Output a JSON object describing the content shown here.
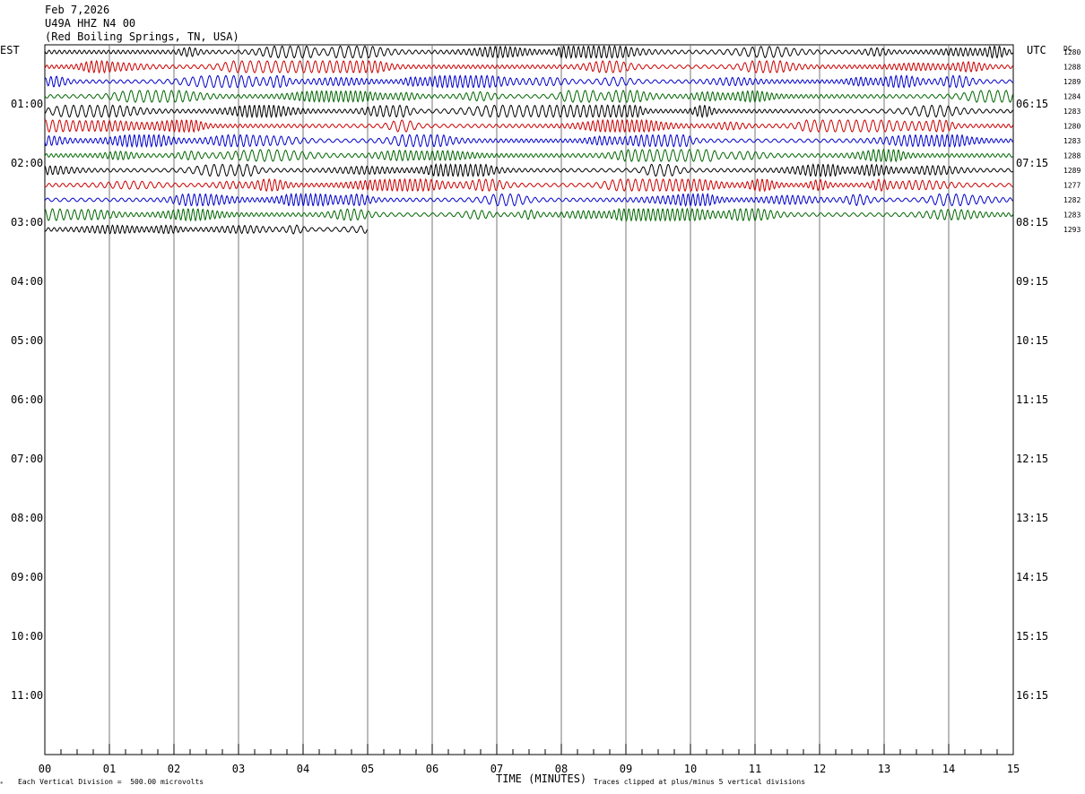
{
  "header": {
    "date": "Feb 7,2026",
    "station": "U49A HHZ N4 00",
    "location": "(Red Boiling Springs, TN, USA)"
  },
  "left_tz": "EST",
  "right_tz": "UTC",
  "dc_label": "DC",
  "footer": {
    "scale_note": "Each Vertical Division =  500.00 microvolts",
    "clip_note": "Traces clipped at plus/minus 5 vertical divisions",
    "xlabel": "TIME (MINUTES)"
  },
  "chart_data": {
    "type": "line",
    "title": "U49A HHZ N4 00",
    "xlabel": "TIME (MINUTES)",
    "xlim": [
      0,
      15
    ],
    "x_ticks": [
      "00",
      "01",
      "02",
      "03",
      "04",
      "05",
      "06",
      "07",
      "08",
      "09",
      "10",
      "11",
      "12",
      "13",
      "14",
      "15"
    ],
    "left_hour_labels": [
      "01:00",
      "02:00",
      "03:00",
      "04:00",
      "05:00",
      "06:00",
      "07:00",
      "08:00",
      "09:00",
      "10:00",
      "11:00"
    ],
    "right_hour_labels": [
      "06:15",
      "07:15",
      "08:15",
      "09:15",
      "10:15",
      "11:15",
      "12:15",
      "13:15",
      "14:15",
      "15:15",
      "16:15"
    ],
    "trace_colors": [
      "#000000",
      "#cc0000",
      "#0000cc",
      "#006600"
    ],
    "traces": [
      {
        "dc": "1280",
        "minutes": 15
      },
      {
        "dc": "1288",
        "minutes": 15
      },
      {
        "dc": "1289",
        "minutes": 15
      },
      {
        "dc": "1284",
        "minutes": 15
      },
      {
        "dc": "1283",
        "minutes": 15
      },
      {
        "dc": "1280",
        "minutes": 15
      },
      {
        "dc": "1283",
        "minutes": 15
      },
      {
        "dc": "1288",
        "minutes": 15
      },
      {
        "dc": "1289",
        "minutes": 15
      },
      {
        "dc": "1277",
        "minutes": 15
      },
      {
        "dc": "1282",
        "minutes": 15
      },
      {
        "dc": "1283",
        "minutes": 15
      },
      {
        "dc": "1293",
        "minutes": 5
      }
    ]
  }
}
